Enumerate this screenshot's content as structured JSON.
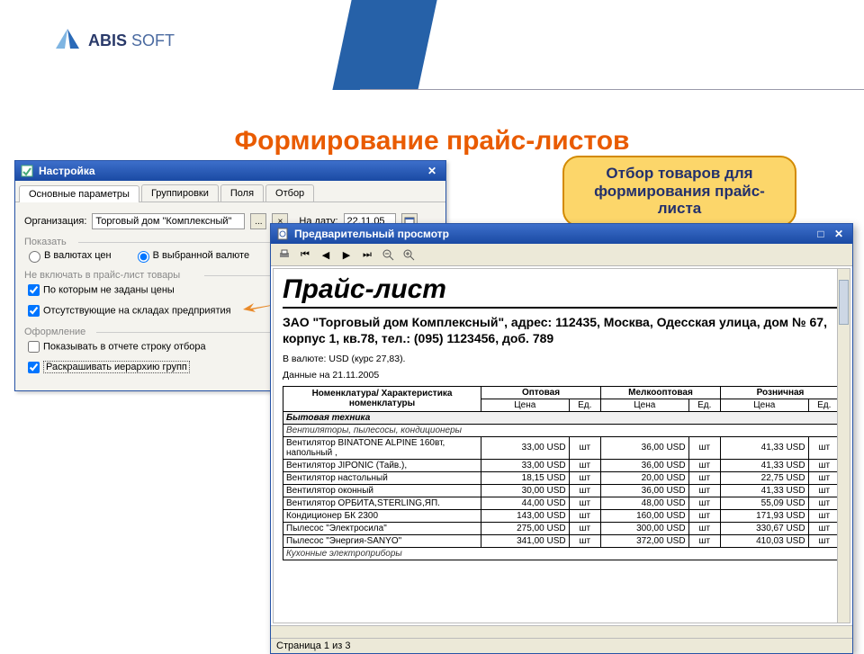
{
  "brand": {
    "name_a": "ABIS",
    "name_b": "SOFT"
  },
  "page_title": "Формирование прайс-листов",
  "callout": "Отбор товаров для формирования прайс-листа",
  "settings": {
    "title": "Настройка",
    "tabs": [
      "Основные параметры",
      "Группировки",
      "Поля",
      "Отбор"
    ],
    "org_label": "Организация:",
    "org_value": "Торговый дом \"Комплексный\"",
    "btn_ellipsis": "...",
    "btn_x": "×",
    "date_label": "На дату:",
    "date_value": "22.11.05",
    "grp_show": "Показать",
    "radio_a": "В валютах цен",
    "radio_b": "В выбранной валюте",
    "grp_excl": "Не включать в прайс-лист товары",
    "chk_noprice": "По которым не заданы цены",
    "chk_nostock": "Отсутствующие на складах предприятия",
    "grp_design": "Оформление",
    "chk_showfilter": "Показывать в отчете строку отбора",
    "chk_color": "Раскрашивать иерархию групп"
  },
  "preview": {
    "title": "Предварительный просмотр",
    "status": "Страница 1 из 3",
    "doc_title": "Прайс-лист",
    "address": "ЗАО \"Торговый дом Комплексный\", адрес: 112435, Москва, Одесская улица, дом № 67, корпус 1, кв.78, тел.: (095) 1123456, доб. 789",
    "meta1": "В валюте: USD (курс 27,83).",
    "meta2": "Данные на 21.11.2005",
    "col_name": "Номенклатура/ Характеристика номенклатуры",
    "price_types": [
      "Оптовая",
      "Мелкооптовая",
      "Розничная"
    ],
    "sub_price": "Цена",
    "sub_unit": "Ед.",
    "cat1": "Бытовая техника",
    "subcat1": "Вентиляторы, пылесосы, кондиционеры",
    "rows": [
      {
        "name": "Вентилятор BINATONE ALPINE 160вт, напольный ,",
        "p": [
          "33,00 USD",
          "шт",
          "36,00 USD",
          "шт",
          "41,33 USD",
          "шт"
        ]
      },
      {
        "name": "Вентилятор JIPONIC (Тайв.),",
        "p": [
          "33,00 USD",
          "шт",
          "36,00 USD",
          "шт",
          "41,33 USD",
          "шт"
        ]
      },
      {
        "name": "Вентилятор настольный",
        "p": [
          "18,15 USD",
          "шт",
          "20,00 USD",
          "шт",
          "22,75 USD",
          "шт"
        ]
      },
      {
        "name": "Вентилятор оконный",
        "p": [
          "30,00 USD",
          "шт",
          "36,00 USD",
          "шт",
          "41,33 USD",
          "шт"
        ]
      },
      {
        "name": "Вентилятор ОРБИТА,STERLING,ЯП.",
        "p": [
          "44,00 USD",
          "шт",
          "48,00 USD",
          "шт",
          "55,09 USD",
          "шт"
        ]
      },
      {
        "name": "Кондиционер БК 2300",
        "p": [
          "143,00 USD",
          "шт",
          "160,00 USD",
          "шт",
          "171,93 USD",
          "шт"
        ]
      },
      {
        "name": "Пылесос \"Электросила\"",
        "p": [
          "275,00 USD",
          "шт",
          "300,00 USD",
          "шт",
          "330,67 USD",
          "шт"
        ]
      },
      {
        "name": "Пылесос \"Энергия-SANYO\"",
        "p": [
          "341,00 USD",
          "шт",
          "372,00 USD",
          "шт",
          "410,03 USD",
          "шт"
        ]
      }
    ],
    "subcat2": "Кухонные электроприборы"
  }
}
